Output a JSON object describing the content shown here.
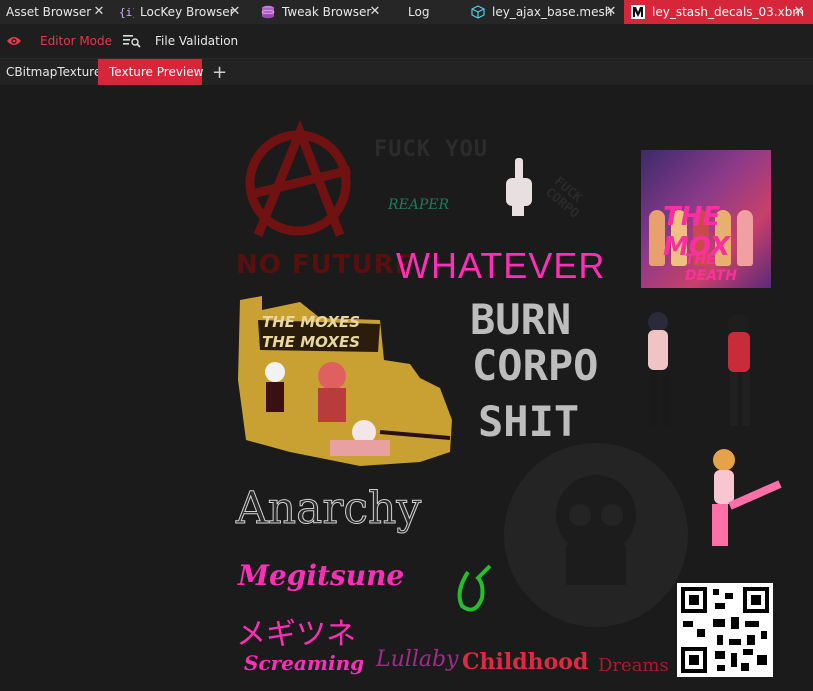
{
  "tabs": [
    {
      "label": "Asset Browser",
      "icon": "none",
      "active": false
    },
    {
      "label": "LocKey Browser",
      "icon": "braces-icon",
      "active": false
    },
    {
      "label": "Tweak Browser",
      "icon": "database-icon",
      "active": false
    },
    {
      "label": "Log",
      "icon": "none",
      "active": false
    },
    {
      "label": "ley_ajax_base.mesh",
      "icon": "cube-icon",
      "active": false
    },
    {
      "label": "ley_stash_decals_03.xbm",
      "icon": "texture-icon",
      "active": true
    }
  ],
  "toolbar": {
    "editor_mode_label": "Editor Mode",
    "file_validation_label": "File Validation"
  },
  "subtabs": {
    "left_label": "CBitmapTexture",
    "active_label": "Texture Preview",
    "add_label": "+"
  },
  "decals": {
    "fuck_you": "FUCK YOU",
    "reaper": "REAPER",
    "no_future": "NO FUTURE",
    "whatever": "WHATEVER",
    "fuck_corpo": "FUCK CORPO",
    "burn": "BURN",
    "corpo": "CORPO",
    "shit": "SHIT",
    "the_moxes_1": "THE MOXES",
    "the_moxes_2": "THE MOXES",
    "the_mox_poster_1": "THE MOX",
    "the_mox_poster_2": "THE DEATH",
    "anarchy": "Anarchy",
    "megitsune": "Megitsune",
    "megitsune_jp": "メギツネ",
    "screaming": "Screaming",
    "lullaby": "Lullaby",
    "childhood": "Childhood",
    "dreams": "Dreams"
  },
  "colors": {
    "accent": "#d6263a",
    "tab_bg": "#262626",
    "canvas_bg": "#1b1b1b",
    "magenta": "#ff2fb8",
    "dark_red": "#6a1010"
  }
}
